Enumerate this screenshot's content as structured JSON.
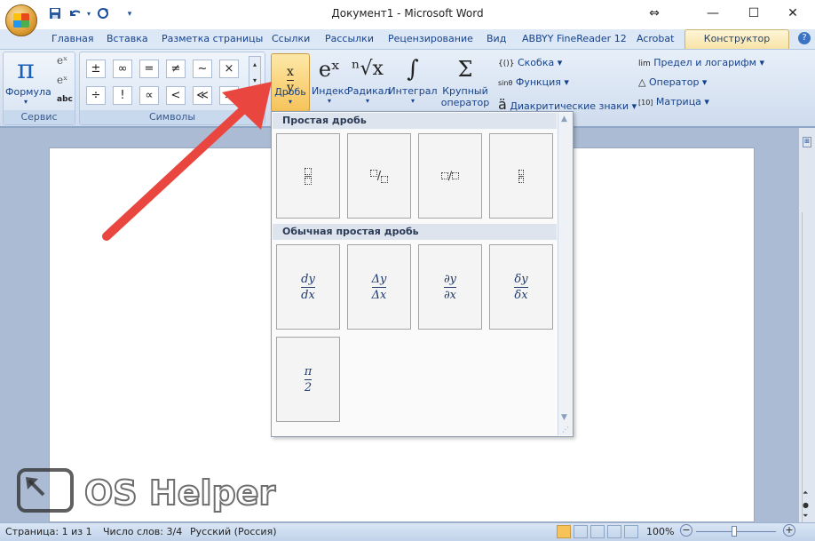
{
  "window": {
    "title": "Документ1 - Microsoft Word",
    "minimize": "—",
    "maximize": "☐",
    "close": "✕",
    "restore_icon": "⇔"
  },
  "qat": {
    "save": "save-icon",
    "undo": "undo-icon",
    "redo": "redo-icon",
    "customize": "customize-qat-icon"
  },
  "tabs": [
    "Главная",
    "Вставка",
    "Разметка страницы",
    "Ссылки",
    "Рассылки",
    "Рецензирование",
    "Вид",
    "ABBYY FineReader 12",
    "Acrobat",
    "Конструктор"
  ],
  "ribbon": {
    "service": {
      "formula": "Формула",
      "group_label": "Сервис",
      "formula_symbol": "π",
      "style_small": "abc"
    },
    "symbols": {
      "row1": [
        "±",
        "∞",
        "=",
        "≠",
        "~",
        "×"
      ],
      "row2": [
        "÷",
        "!",
        "∝",
        "<",
        "≪",
        ">"
      ],
      "group_label": "Символы"
    },
    "structures": [
      {
        "label": "Дробь",
        "symbol": "x/y"
      },
      {
        "label": "Индекс",
        "symbol": "eˣ"
      },
      {
        "label": "Радикал",
        "symbol": "ⁿ√x"
      },
      {
        "label": "Интеграл",
        "symbol": "∫"
      },
      {
        "label1": "Крупный",
        "label2": "оператор",
        "symbol": "Σ"
      }
    ],
    "small": [
      {
        "icon": "{()}",
        "label": "Скобка"
      },
      {
        "icon": "sinθ",
        "label": "Функция"
      },
      {
        "icon": "ä",
        "label": "Диакритические знаки"
      },
      {
        "icon": "lim",
        "label": "Предел и логарифм"
      },
      {
        "icon": "△",
        "label": "Оператор"
      },
      {
        "icon": "[10]",
        "label": "Матрица"
      }
    ]
  },
  "dropdown": {
    "section1": "Простая дробь",
    "section2": "Обычная простая дробь",
    "common": [
      {
        "num": "dy",
        "den": "dx"
      },
      {
        "num": "Δy",
        "den": "Δx"
      },
      {
        "num": "∂y",
        "den": "∂x"
      },
      {
        "num": "δy",
        "den": "δx"
      },
      {
        "num": "π",
        "den": "2"
      }
    ],
    "simple_labels": [
      "/",
      " /"
    ]
  },
  "status": {
    "page": "Страница: 1 из 1",
    "words": "Число слов: 3/4",
    "lang": "Русский (Россия)",
    "zoom": "100%",
    "zoom_minus": "−",
    "zoom_plus": "+"
  },
  "watermark": {
    "text": "OS Helper"
  },
  "colors": {
    "accent": "#f6e3a6",
    "arrow": "#e8463f",
    "ribbon": "#dde8f6"
  }
}
